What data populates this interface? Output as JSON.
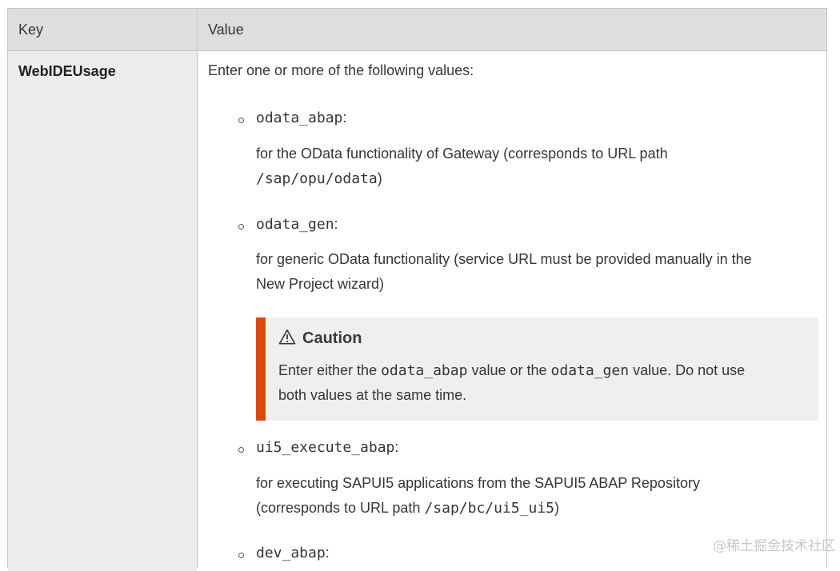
{
  "table": {
    "header": {
      "key": "Key",
      "value": "Value"
    },
    "row": {
      "key": "WebIDEUsage",
      "intro": "Enter one or more of the following values:",
      "items": [
        {
          "name": "odata_abap",
          "suffix": ":",
          "desc_line1": "for the OData functionality of Gateway (corresponds to URL path",
          "desc_line2_code": "/sap/opu/odata",
          "desc_line2_suffix": ")"
        },
        {
          "name": "odata_gen",
          "suffix": ":",
          "desc_line1": "for generic OData functionality (service URL must be provided manually in the",
          "desc_line2": "New Project wizard)"
        },
        {
          "name": "ui5_execute_abap",
          "suffix": ":",
          "desc_line1": "for executing SAPUI5 applications from the SAPUI5 ABAP Repository",
          "desc_line2_prefix": "(corresponds to URL path ",
          "desc_line2_code": "/sap/bc/ui5_ui5",
          "desc_line2_suffix": ")"
        },
        {
          "name": "dev_abap",
          "suffix": ":"
        }
      ],
      "caution": {
        "title": "Caution",
        "icon": "warning-triangle-icon",
        "text_a": "Enter either the ",
        "code_a": "odata_abap",
        "text_b": " value or the ",
        "code_b": "odata_gen",
        "text_c": " value. Do not use",
        "line2": "both values at the same time.",
        "accent_color": "#d9480f"
      }
    }
  },
  "watermark": "@稀土掘金技术社区"
}
